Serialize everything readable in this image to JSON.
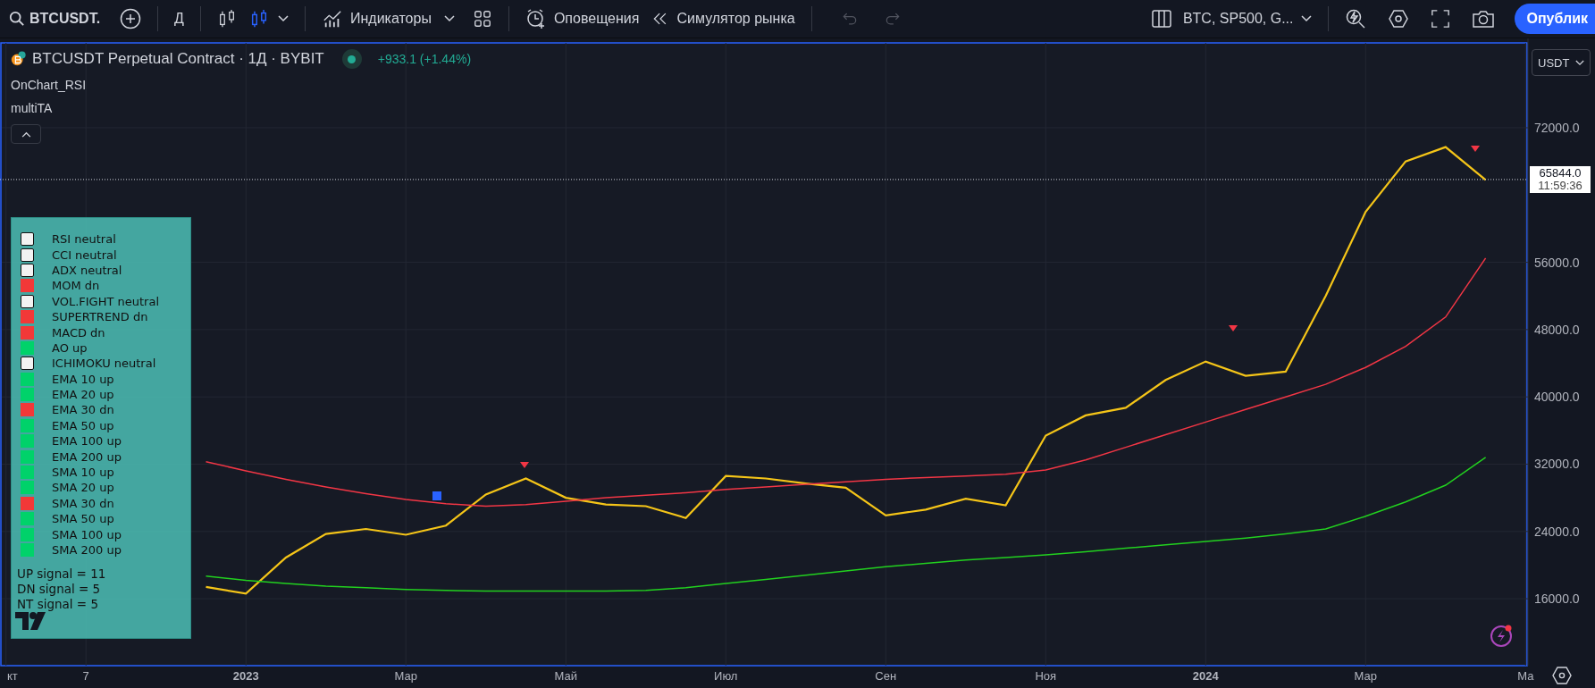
{
  "toolbar": {
    "symbol": "BTCUSDT.",
    "interval": "Д",
    "indicators": "Индикаторы",
    "alerts": "Оповещения",
    "replay": "Симулятор рынка",
    "watchlist": "BTC, SP500, G...",
    "publish": "Опублик"
  },
  "chart": {
    "title": "BTCUSDT Perpetual Contract · 1Д · BYBIT",
    "change": "+933.1 (+1.44%)",
    "studies": [
      "OnChart_RSI",
      "multiTA"
    ],
    "currency": "USDT",
    "last_price": "65844.0",
    "countdown": "11:59:36",
    "signals": [
      {
        "label": "RSI neutral",
        "kind": "neutral"
      },
      {
        "label": "CCI neutral",
        "kind": "neutral"
      },
      {
        "label": "ADX neutral",
        "kind": "neutral"
      },
      {
        "label": "MOM dn",
        "kind": "dn"
      },
      {
        "label": "VOL.FIGHT neutral",
        "kind": "neutral"
      },
      {
        "label": "SUPERTREND dn",
        "kind": "dn"
      },
      {
        "label": "MACD dn",
        "kind": "dn"
      },
      {
        "label": "AO up",
        "kind": "up"
      },
      {
        "label": "ICHIMOKU neutral",
        "kind": "neutral"
      },
      {
        "label": "EMA 10 up",
        "kind": "up"
      },
      {
        "label": "EMA 20 up",
        "kind": "up"
      },
      {
        "label": "EMA 30 dn",
        "kind": "dn"
      },
      {
        "label": "EMA 50 up",
        "kind": "up"
      },
      {
        "label": "EMA 100 up",
        "kind": "up"
      },
      {
        "label": "EMA 200 up",
        "kind": "up"
      },
      {
        "label": "SMA 10 up",
        "kind": "up"
      },
      {
        "label": "SMA 20 up",
        "kind": "up"
      },
      {
        "label": "SMA 30 dn",
        "kind": "dn"
      },
      {
        "label": "SMA 50 up",
        "kind": "up"
      },
      {
        "label": "SMA 100 up",
        "kind": "up"
      },
      {
        "label": "SMA 200 up",
        "kind": "up"
      }
    ],
    "totals": [
      "UP signal = 11",
      "DN signal = 5",
      "NT signal = 5"
    ],
    "chart_data": {
      "type": "line",
      "grid": true,
      "ylim": [
        8040,
        82090
      ],
      "ref_lines": [
        {
          "axis": "y",
          "value": 65844
        }
      ],
      "categories": [
        "кт",
        null,
        "7",
        null,
        null,
        null,
        "2023",
        null,
        null,
        null,
        "Мар",
        null,
        null,
        null,
        "Май",
        null,
        null,
        null,
        "Июл",
        null,
        null,
        null,
        "Сен",
        null,
        null,
        null,
        "Ноя",
        null,
        null,
        null,
        "2024",
        null,
        null,
        null,
        "Мар",
        null,
        null,
        null,
        "Ма"
      ],
      "yticks": [
        {
          "value": 16000,
          "label": "16000.0"
        },
        {
          "value": 24000,
          "label": "24000.0"
        },
        {
          "value": 32000,
          "label": "32000.0"
        },
        {
          "value": 40000,
          "label": "40000.0"
        },
        {
          "value": 48000,
          "label": "48000.0"
        },
        {
          "value": 56000,
          "label": "56000.0"
        },
        {
          "value": 72000,
          "label": "72000.0"
        }
      ],
      "series": [
        {
          "color": "#f5c518",
          "values": [
            null,
            null,
            null,
            null,
            null,
            17400,
            16600,
            20900,
            23700,
            24300,
            23600,
            24700,
            28400,
            30300,
            28000,
            27200,
            27000,
            25600,
            30600,
            30300,
            29700,
            29200,
            25900,
            26600,
            27900,
            27100,
            35400,
            37800,
            38700,
            42000,
            44200,
            42500,
            43000,
            52000,
            62000,
            68000,
            69700,
            65800,
            null
          ]
        },
        {
          "color": "#f23645",
          "values": [
            null,
            null,
            null,
            null,
            null,
            32300,
            31200,
            30200,
            29300,
            28500,
            27800,
            27300,
            27000,
            27200,
            27600,
            28000,
            28300,
            28600,
            29000,
            29300,
            29600,
            29900,
            30200,
            30400,
            30600,
            30800,
            31300,
            32500,
            34000,
            35500,
            37000,
            38500,
            40000,
            41500,
            43500,
            46000,
            49500,
            56500,
            null
          ]
        },
        {
          "color": "#22d11f",
          "values": [
            null,
            null,
            null,
            null,
            null,
            18700,
            18200,
            17800,
            17500,
            17300,
            17100,
            17000,
            16900,
            16900,
            16900,
            16900,
            17000,
            17300,
            17800,
            18300,
            18800,
            19300,
            19800,
            20200,
            20600,
            20900,
            21200,
            21600,
            22000,
            22400,
            22800,
            23200,
            23700,
            24300,
            25800,
            27500,
            29500,
            32800,
            null
          ]
        }
      ]
    }
  }
}
